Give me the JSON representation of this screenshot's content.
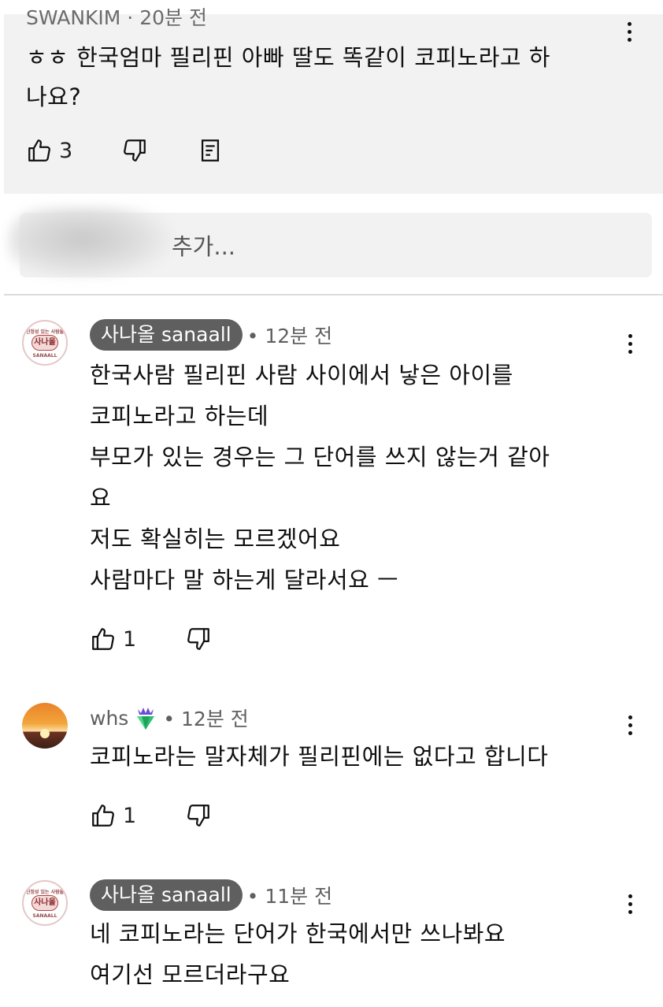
{
  "top_comment": {
    "author": "SWANKIM · 20분 전",
    "lines": [
      "ㅎㅎ 한국엄마 필리핀 아빠 딸도 똑같이 코피노라고 하",
      "나요?"
    ],
    "likes": "3"
  },
  "reply_input": {
    "placeholder": "추가..."
  },
  "comments": [
    {
      "author": "사나올 sanaall",
      "time": "• 12분 전",
      "avatar_text": "사나올",
      "avatar_ring_top": "진정성 있는 사람들",
      "avatar_ring_bottom": "SANAALL",
      "lines": [
        "한국사람 필리핀 사람 사이에서 낳은 아이를",
        "코피노라고 하는데",
        "부모가 있는 경우는 그 단어를 쓰지 않는거 같아",
        "요",
        "저도 확실히는 모르겠어요",
        "사람마다 말 하는게 달라서요 ㅡ"
      ],
      "likes": "1"
    },
    {
      "author": "whs",
      "time": "• 12분 전",
      "badge_icon": "diamond-badge-icon",
      "lines": [
        "코피노라는 말자체가 필리핀에는 없다고 합니다"
      ],
      "likes": "1"
    },
    {
      "author": "사나올 sanaall",
      "time": "• 11분 전",
      "avatar_text": "사나올",
      "avatar_ring_top": "진정성 있는 사람들",
      "avatar_ring_bottom": "SANAALL",
      "lines": [
        "네 코피노라는 단어가 한국에서만 쓰나봐요",
        "여기선 모르더라구요"
      ]
    }
  ],
  "icons": {
    "like": "thumbs-up-icon",
    "dislike": "thumbs-down-icon",
    "reply": "reply-icon",
    "menu": "more-vert-icon"
  },
  "colors": {
    "chip": "#5f5f5f",
    "card": "#f2f2f2",
    "meta": "#606060"
  }
}
